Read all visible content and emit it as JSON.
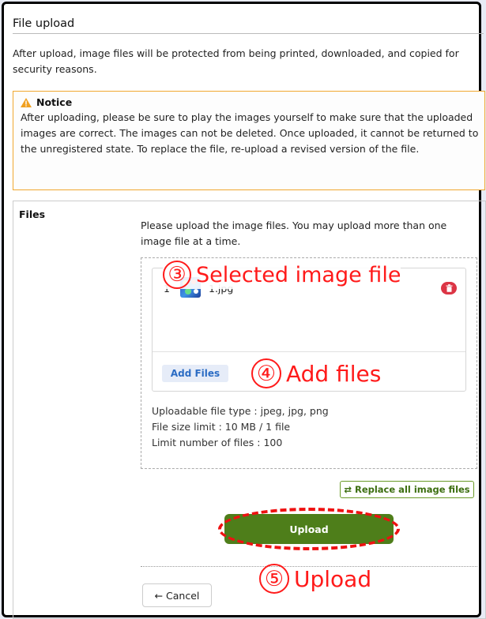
{
  "page": {
    "title": "File upload",
    "description": "After upload, image files will be protected from being printed, downloaded, and copied for security reasons."
  },
  "notice": {
    "heading": "Notice",
    "body": "After uploading, please be sure to play the images yourself to make sure that the uploaded images are correct. The images can not be deleted. Once uploaded, it cannot be returned to the unregistered state. To replace the file, re-upload a revised version of the file.",
    "icon": "warning-icon"
  },
  "files": {
    "label": "Files",
    "instructions": "Please upload the image files. You may upload more than one image file at a time.",
    "list": [
      {
        "index": "1",
        "name": "1.jpg"
      }
    ],
    "add_files_label": "Add Files",
    "info": [
      "Uploadable file type : jpeg, jpg, png",
      "File size limit : 10 MB / 1 file",
      "Limit number of files : 100"
    ]
  },
  "actions": {
    "replace_label": "Replace all image files",
    "replace_icon": "swap-arrows-icon",
    "upload_label": "Upload",
    "cancel_label": "← Cancel"
  },
  "annotations": {
    "step3": {
      "number": "③",
      "text": "Selected image file"
    },
    "step4": {
      "number": "④",
      "text": "Add files"
    },
    "step5": {
      "number": "⑤",
      "text": "Upload"
    }
  },
  "colors": {
    "annotation": "#ff1a1a",
    "upload_button": "#4e7e1a",
    "notice_border": "#f0a830",
    "delete_button": "#dc3545",
    "link_blue": "#2b6cc4"
  }
}
